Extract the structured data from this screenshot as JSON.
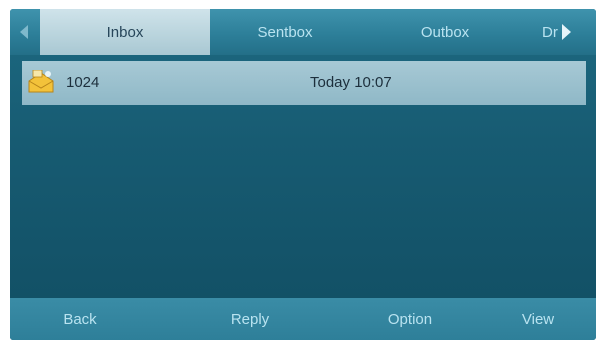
{
  "tabs": [
    {
      "label": "Inbox",
      "active": true
    },
    {
      "label": "Sentbox",
      "active": false
    },
    {
      "label": "Outbox",
      "active": false
    },
    {
      "label": "Dr",
      "active": false
    }
  ],
  "nav_icons": [
    "scroll-left-icon",
    "scroll-right-icon"
  ],
  "messages": [
    {
      "icon": "unread-envelope-icon",
      "from": "1024",
      "time": "Today 10:07"
    }
  ],
  "softkeys": [
    "Back",
    "Reply",
    "Option",
    "View"
  ],
  "colors": {
    "screen_bg": "#175b72",
    "tab_active_bg": "#c0d8e0",
    "row_highlight": "#9cc0cd",
    "softkey_bar": "#3386a0",
    "inactive_text": "#b9e3f0"
  }
}
